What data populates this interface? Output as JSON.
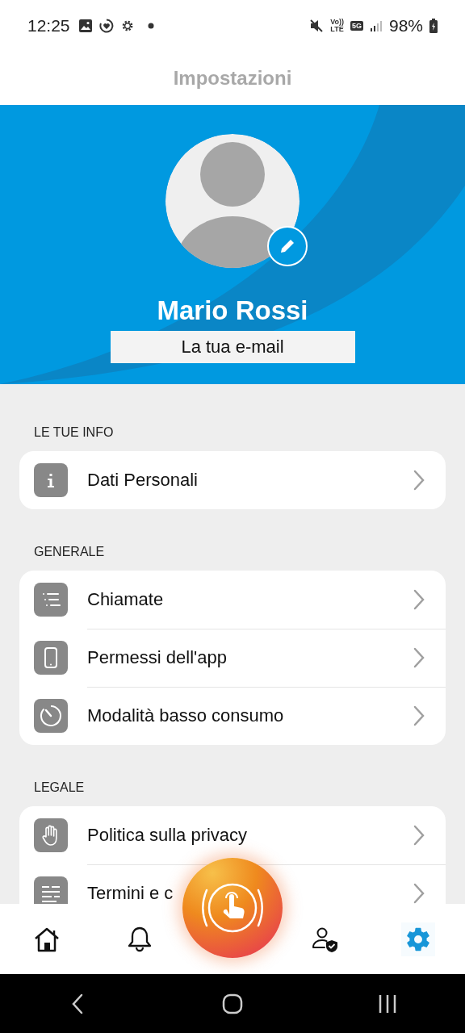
{
  "status_bar": {
    "time": "12:25",
    "volte_top": "Vo))",
    "volte_bottom": "LTE",
    "network": "5G",
    "battery": "98%"
  },
  "header": {
    "title": "Impostazioni"
  },
  "profile": {
    "name": "Mario Rossi",
    "email": "La tua e-mail"
  },
  "sections": [
    {
      "title": "LE TUE INFO",
      "items": [
        {
          "kind": "info",
          "label": "Dati Personali"
        }
      ]
    },
    {
      "title": "GENERALE",
      "items": [
        {
          "kind": "list",
          "label": "Chiamate"
        },
        {
          "kind": "phone",
          "label": "Permessi dell'app"
        },
        {
          "kind": "timer",
          "label": "Modalità basso consumo"
        }
      ]
    },
    {
      "title": "LEGALE",
      "items": [
        {
          "kind": "hand",
          "label": "Politica sulla privacy"
        },
        {
          "kind": "lines",
          "label": "Termini e c"
        }
      ]
    }
  ],
  "nav": [
    {
      "kind": "home",
      "selected": false
    },
    {
      "kind": "bell",
      "selected": false
    },
    {
      "kind": "alarm",
      "selected": false
    },
    {
      "kind": "account",
      "selected": false
    },
    {
      "kind": "settings",
      "selected": true
    }
  ]
}
